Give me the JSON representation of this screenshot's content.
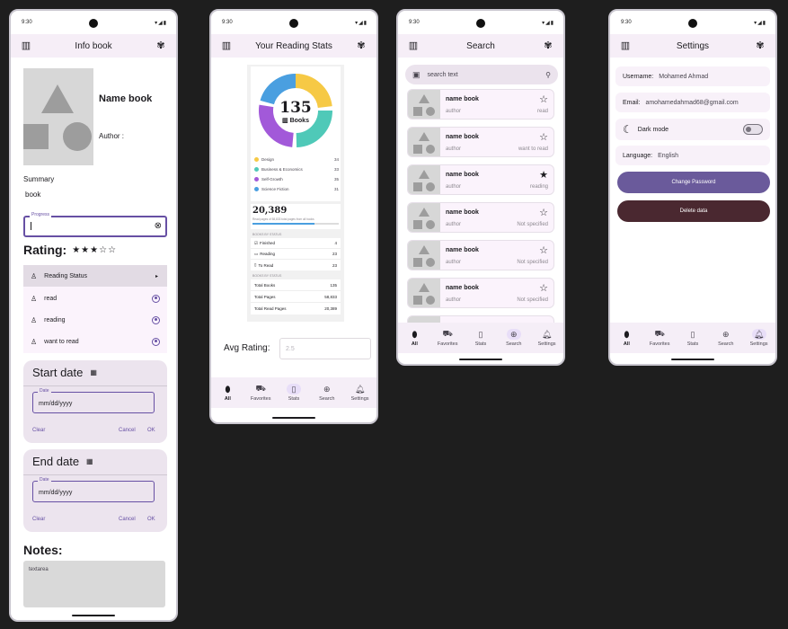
{
  "status_time": "9:30",
  "nav": [
    "All",
    "Favorites",
    "Stats",
    "Search",
    "Settings"
  ],
  "info": {
    "title": "Info book",
    "name": "Name book",
    "author": "Author :",
    "summary_label": "Summary",
    "summary_value": "book",
    "progress_label": "Progress",
    "rating_label": "Rating:",
    "rating_stars": "★★★☆☆",
    "reading_status": "Reading Status",
    "options": [
      "read",
      "reading",
      "want to read"
    ],
    "start_date": "Start date",
    "end_date": "End date",
    "date_label": "Date",
    "date_placeholder": "mm/dd/yyyy",
    "clear": "Clear",
    "cancel": "Cancel",
    "ok": "OK",
    "notes": "Notes:",
    "textarea": "textarea"
  },
  "stats": {
    "title": "Your Reading Stats",
    "total": "135",
    "books_label": "Books",
    "legend": [
      {
        "name": "Design",
        "value": "34",
        "color": "#f6c945"
      },
      {
        "name": "Business & Economics",
        "value": "33",
        "color": "#4fc9b8"
      },
      {
        "name": "Self-Growth",
        "value": "35",
        "color": "#a259d9"
      },
      {
        "name": "Science Fiction",
        "value": "31",
        "color": "#4a9fe0"
      }
    ],
    "pages_total": "20,389",
    "pages_caption": "Read pages of 58,833 total pages from all books",
    "by_status_header": "BOOKS BY STATUS",
    "status_rows": [
      {
        "label": "Finished",
        "value": "4"
      },
      {
        "label": "Reading",
        "value": "23"
      },
      {
        "label": "To Read",
        "value": "23"
      }
    ],
    "by_stats_header": "BOOKS BY STATUS",
    "total_rows": [
      {
        "label": "Total Books",
        "value": "135"
      },
      {
        "label": "Total Pages",
        "value": "58,833"
      },
      {
        "label": "Total Read Pages",
        "value": "20,389"
      }
    ],
    "avg_rating_label": "Avg Rating:",
    "avg_rating_placeholder": "2.5"
  },
  "search": {
    "title": "Search",
    "placeholder": "search text",
    "cards": [
      {
        "name": "name book",
        "author": "author",
        "status": "read",
        "star": "☆"
      },
      {
        "name": "name book",
        "author": "author",
        "status": "want to read",
        "star": "☆"
      },
      {
        "name": "name book",
        "author": "author",
        "status": "reading",
        "star": "★"
      },
      {
        "name": "name book",
        "author": "author",
        "status": "Not specified",
        "star": "☆"
      },
      {
        "name": "name book",
        "author": "author",
        "status": "Not specified",
        "star": "☆"
      },
      {
        "name": "name book",
        "author": "author",
        "status": "Not specified",
        "star": "☆"
      }
    ]
  },
  "settings": {
    "title": "Settings",
    "username_label": "Username:",
    "username": "Mohamed Ahmad",
    "email_label": "Email:",
    "email": "amohamedahmad68@gmail.com",
    "dark_mode": "Dark mode",
    "language_label": "Language:",
    "language": "English",
    "change_password": "Change Password",
    "delete_data": "Delete data"
  },
  "colors": {
    "primary": "#6750a4",
    "danger": "#4a2830",
    "surface": "#f6eef7"
  }
}
